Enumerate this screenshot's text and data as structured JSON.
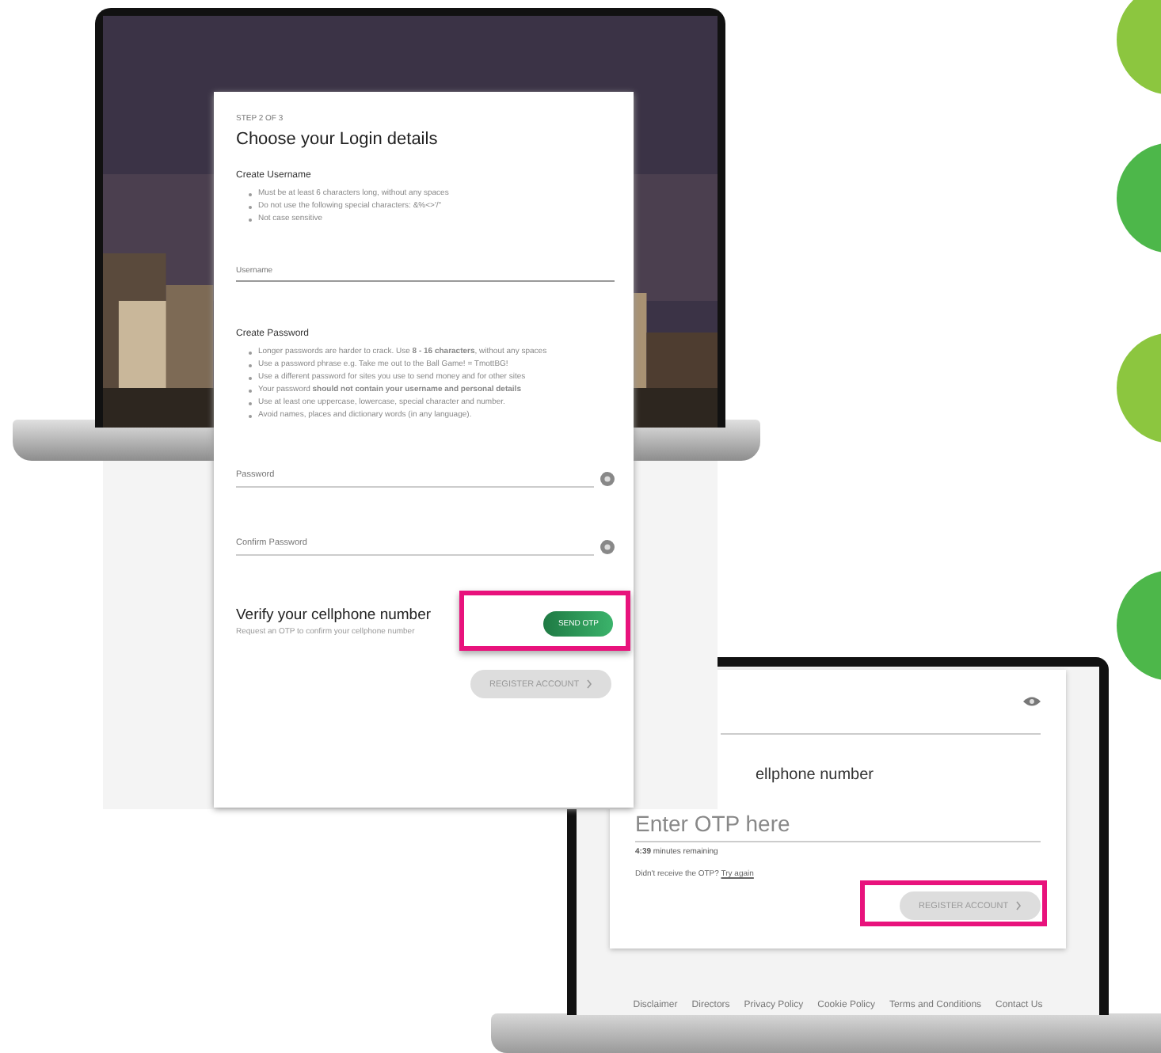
{
  "registration_form": {
    "step": "STEP 2 OF 3",
    "title": "Choose your Login details",
    "username_section": {
      "heading": "Create Username",
      "rules": [
        "Must be at least 6 characters long, without any spaces",
        "Do not use the following special characters: &%<>'/\"",
        "Not case sensitive"
      ],
      "field": {
        "placeholder": "Username"
      }
    },
    "password_section": {
      "heading": "Create Password",
      "rules": [
        "Longer passwords are harder to crack. Use **8 - 16 characters**, without any spaces",
        "Use a password phrase e.g. Take me out to the Ball Game! = TmottBG!",
        "Use a different password for sites you use to send money and for other sites",
        "Your password **should not contain your username and personal details**",
        "Use at least one uppercase, lowercase, special character and number.",
        "Avoid names, places and dictionary words (in any language)."
      ],
      "fields": [
        {
          "placeholder": "Password"
        },
        {
          "placeholder": "Confirm Password"
        }
      ]
    },
    "verify": {
      "heading": "Verify your cellphone number",
      "hint": "Request an OTP to confirm your cellphone number",
      "button": "SEND OTP",
      "highlighted": true
    },
    "register_button": {
      "label": "REGISTER ACCOUNT",
      "disabled": true
    }
  },
  "otp_screen": {
    "heading": "ellphone number",
    "otp_field": {
      "placeholder": "Enter OTP here"
    },
    "timer": "4:39",
    "timer_text": "minutes remaining",
    "resend_text": "Didn't receive the OTP?",
    "resend_link": "Try again",
    "register_button": {
      "label": "REGISTER ACCOUNT",
      "disabled": true,
      "highlighted": true
    },
    "footer_links": [
      "Disclaimer",
      "Directors",
      "Privacy Policy",
      "Cookie Policy",
      "Terms and Conditions",
      "Contact Us"
    ]
  },
  "step_markers": [
    {
      "color": "#8cc63f"
    },
    {
      "color": "#4db74a"
    },
    {
      "color": "#8cc63f"
    },
    {
      "color": "#4db74a"
    }
  ]
}
